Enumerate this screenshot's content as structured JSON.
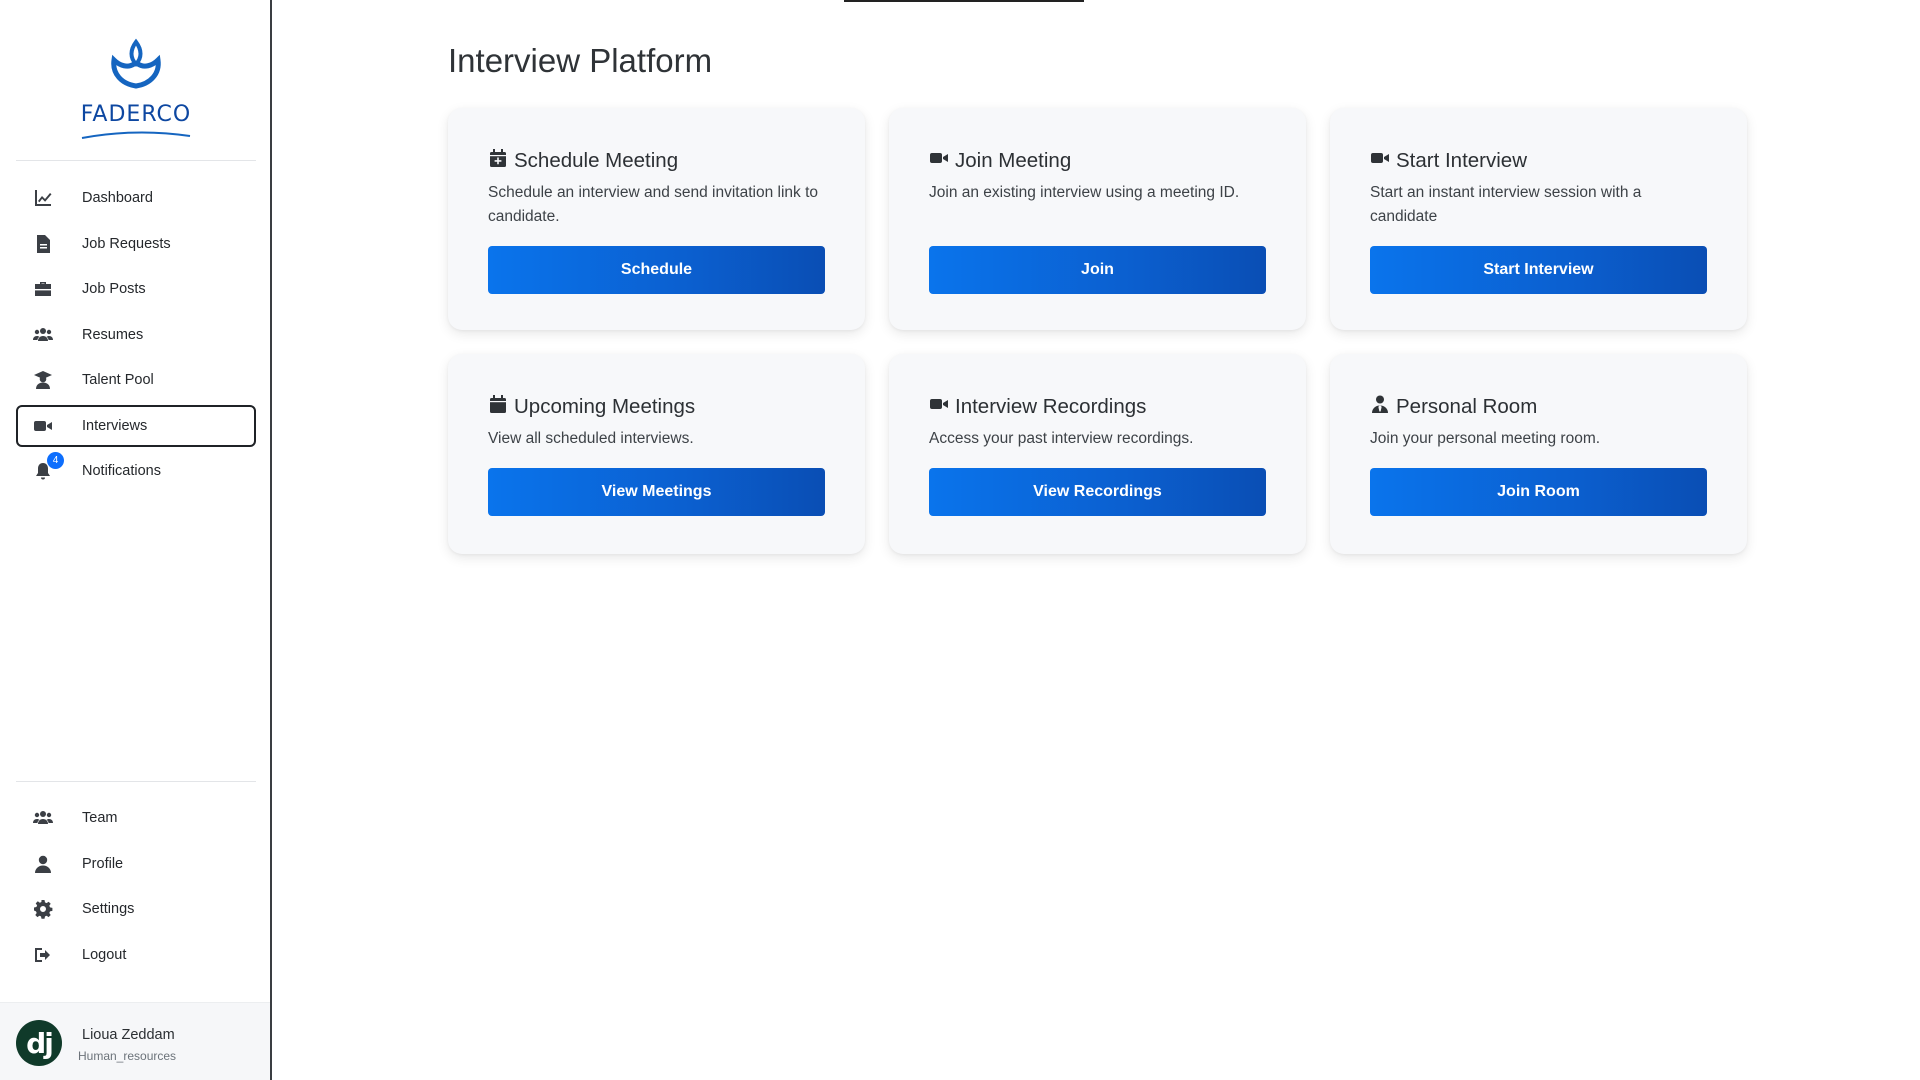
{
  "brand": {
    "name": "FADERCO",
    "color": "#0d47a1"
  },
  "accent_color": "#0b63d6",
  "sidebar": {
    "main_items": [
      {
        "label": "Dashboard",
        "icon": "chart-line-icon"
      },
      {
        "label": "Job Requests",
        "icon": "document-icon"
      },
      {
        "label": "Job Posts",
        "icon": "briefcase-icon"
      },
      {
        "label": "Resumes",
        "icon": "users-icon"
      },
      {
        "label": "Talent Pool",
        "icon": "graduate-icon"
      },
      {
        "label": "Interviews",
        "icon": "video-icon",
        "active": true
      },
      {
        "label": "Notifications",
        "icon": "bell-icon",
        "badge": "4"
      }
    ],
    "bottom_items": [
      {
        "label": "Team",
        "icon": "users-icon"
      },
      {
        "label": "Profile",
        "icon": "user-icon"
      },
      {
        "label": "Settings",
        "icon": "gear-icon"
      },
      {
        "label": "Logout",
        "icon": "logout-icon"
      }
    ],
    "user": {
      "avatar_text": "dj",
      "name": "Lioua Zeddam",
      "role": "Human_resources"
    }
  },
  "main": {
    "title": "Interview Platform",
    "cards": [
      {
        "icon": "calendar-plus-icon",
        "title": "Schedule Meeting",
        "description": "Schedule an interview and send invitation link to candidate.",
        "button": "Schedule"
      },
      {
        "icon": "video-icon",
        "title": "Join Meeting",
        "description": "Join an existing interview using a meeting ID.",
        "button": "Join"
      },
      {
        "icon": "video-icon",
        "title": "Start Interview",
        "description": "Start an instant interview session with a candidate",
        "button": "Start Interview"
      },
      {
        "icon": "calendar-icon",
        "title": "Upcoming Meetings",
        "description": "View all scheduled interviews.",
        "button": "View Meetings"
      },
      {
        "icon": "video-icon",
        "title": "Interview Recordings",
        "description": "Access your past interview recordings.",
        "button": "View Recordings"
      },
      {
        "icon": "user-tie-icon",
        "title": "Personal Room",
        "description": "Join your personal meeting room.",
        "button": "Join Room"
      }
    ]
  }
}
